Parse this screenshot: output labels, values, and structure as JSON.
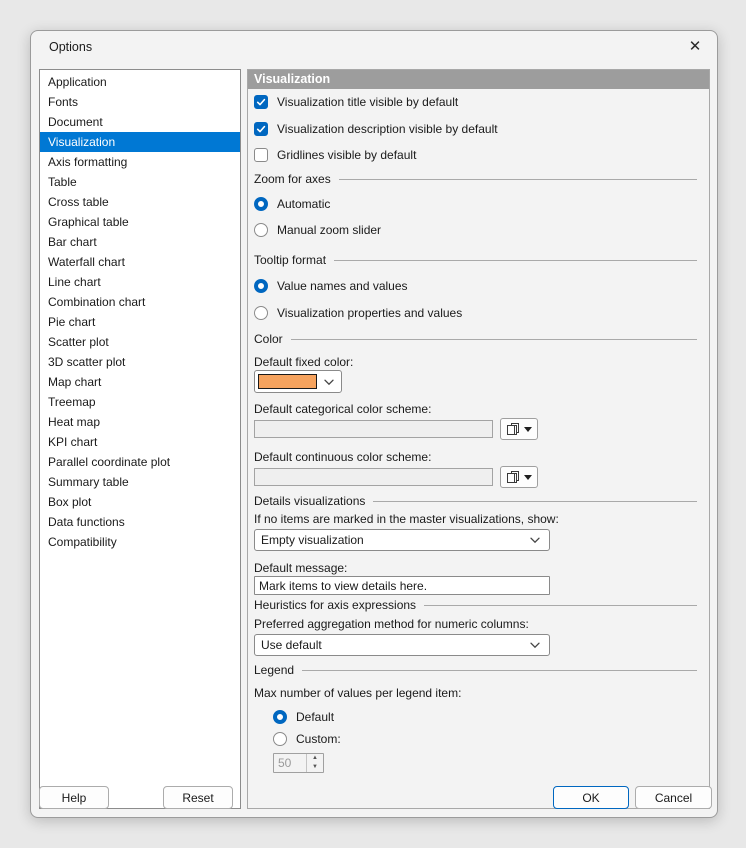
{
  "window": {
    "title": "Options",
    "close_icon": "✕"
  },
  "sidebar": {
    "items": [
      {
        "label": "Application",
        "selected": false
      },
      {
        "label": "Fonts",
        "selected": false
      },
      {
        "label": "Document",
        "selected": false
      },
      {
        "label": "Visualization",
        "selected": true
      },
      {
        "label": "Axis formatting",
        "selected": false
      },
      {
        "label": "Table",
        "selected": false
      },
      {
        "label": "Cross table",
        "selected": false
      },
      {
        "label": "Graphical table",
        "selected": false
      },
      {
        "label": "Bar chart",
        "selected": false
      },
      {
        "label": "Waterfall chart",
        "selected": false
      },
      {
        "label": "Line chart",
        "selected": false
      },
      {
        "label": "Combination chart",
        "selected": false
      },
      {
        "label": "Pie chart",
        "selected": false
      },
      {
        "label": "Scatter plot",
        "selected": false
      },
      {
        "label": "3D scatter plot",
        "selected": false
      },
      {
        "label": "Map chart",
        "selected": false
      },
      {
        "label": "Treemap",
        "selected": false
      },
      {
        "label": "Heat map",
        "selected": false
      },
      {
        "label": "KPI chart",
        "selected": false
      },
      {
        "label": "Parallel coordinate plot",
        "selected": false
      },
      {
        "label": "Summary table",
        "selected": false
      },
      {
        "label": "Box plot",
        "selected": false
      },
      {
        "label": "Data functions",
        "selected": false
      },
      {
        "label": "Compatibility",
        "selected": false
      }
    ]
  },
  "panel": {
    "header": "Visualization",
    "checkboxes": [
      {
        "label": "Visualization title visible by default",
        "checked": true
      },
      {
        "label": "Visualization description visible by default",
        "checked": true
      },
      {
        "label": "Gridlines visible by default",
        "checked": false
      }
    ],
    "zoom_group": {
      "title": "Zoom for axes",
      "options": [
        {
          "label": "Automatic",
          "selected": true
        },
        {
          "label": "Manual zoom slider",
          "selected": false
        }
      ]
    },
    "tooltip_group": {
      "title": "Tooltip format",
      "options": [
        {
          "label": "Value names and values",
          "selected": true
        },
        {
          "label": "Visualization properties and values",
          "selected": false
        }
      ]
    },
    "color_group": {
      "title": "Color",
      "fixed_color_label": "Default fixed color:",
      "fixed_color_value": "#F6A35E",
      "categorical_label": "Default categorical color scheme:",
      "categorical_value": "",
      "continuous_label": "Default continuous color scheme:",
      "continuous_value": ""
    },
    "details_group": {
      "title": "Details visualizations",
      "no_items_label": "If no items are marked in the master visualizations, show:",
      "no_items_value": "Empty visualization",
      "default_message_label": "Default message:",
      "default_message_value": "Mark items to view details here."
    },
    "heuristics_group": {
      "title": "Heuristics for axis expressions",
      "aggregation_label": "Preferred aggregation method for numeric columns:",
      "aggregation_value": "Use default"
    },
    "legend_group": {
      "title": "Legend",
      "max_values_label": "Max number of values per legend item:",
      "options": [
        {
          "label": "Default",
          "selected": true
        },
        {
          "label": "Custom:",
          "selected": false
        }
      ],
      "custom_value": "50"
    }
  },
  "footer": {
    "help_label": "Help",
    "reset_label": "Reset",
    "ok_label": "OK",
    "cancel_label": "Cancel"
  }
}
